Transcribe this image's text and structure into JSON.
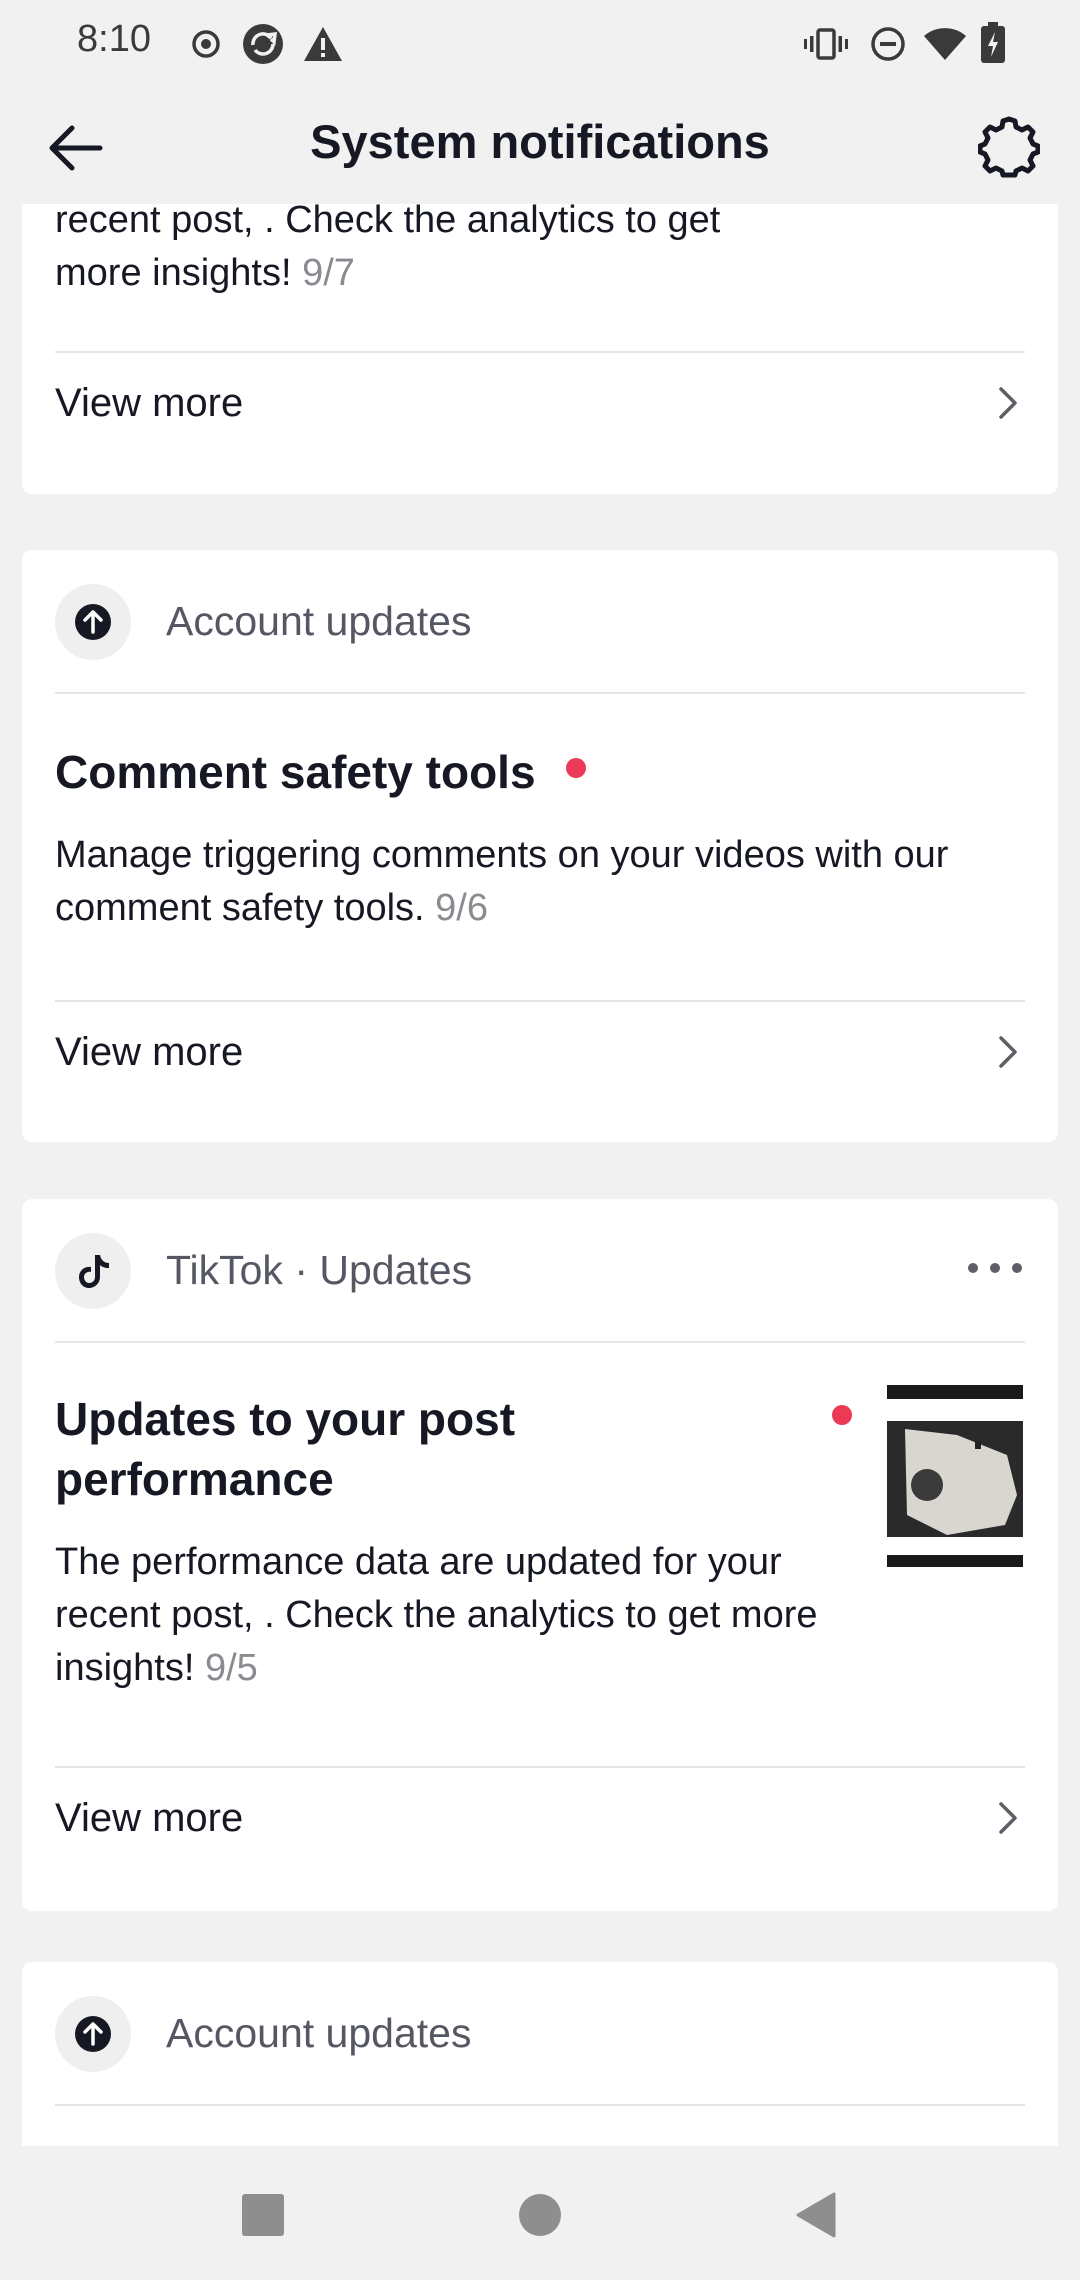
{
  "status_bar": {
    "time": "8:10",
    "icons_left": [
      "record-icon",
      "sync-icon",
      "warning-icon"
    ],
    "icons_right": [
      "vibrate-icon",
      "dnd-icon",
      "wifi-icon",
      "battery-icon"
    ]
  },
  "header": {
    "title": "System notifications",
    "back_icon": "arrow-left-icon",
    "settings_icon": "gear-icon"
  },
  "cards": [
    {
      "body_partial_line1": "recent post, . Check the analytics to get",
      "body_partial_line2": "more insights!",
      "date": "9/7",
      "view_more": "View more"
    },
    {
      "source": "Account updates",
      "title": "Comment safety tools",
      "body": "Manage triggering comments on your videos with our comment safety tools.",
      "date": "9/6",
      "view_more": "View more",
      "unread": true
    },
    {
      "source": "TikTok",
      "source_suffix": "· Updates",
      "title": "Updates to your post performance",
      "body": "The performance data are updated for your recent post, . Check the analytics to get more insights!",
      "date": "9/5",
      "view_more": "View more",
      "unread": true
    },
    {
      "source": "Account updates"
    }
  ],
  "nav": {
    "recents_icon": "square-icon",
    "home_icon": "circle-icon",
    "back_icon": "triangle-back-icon"
  },
  "colors": {
    "background": "#f1f1f2",
    "card": "#ffffff",
    "unread_dot": "#ea3a56",
    "muted_text": "#8a8b91",
    "primary_text": "#161823"
  }
}
